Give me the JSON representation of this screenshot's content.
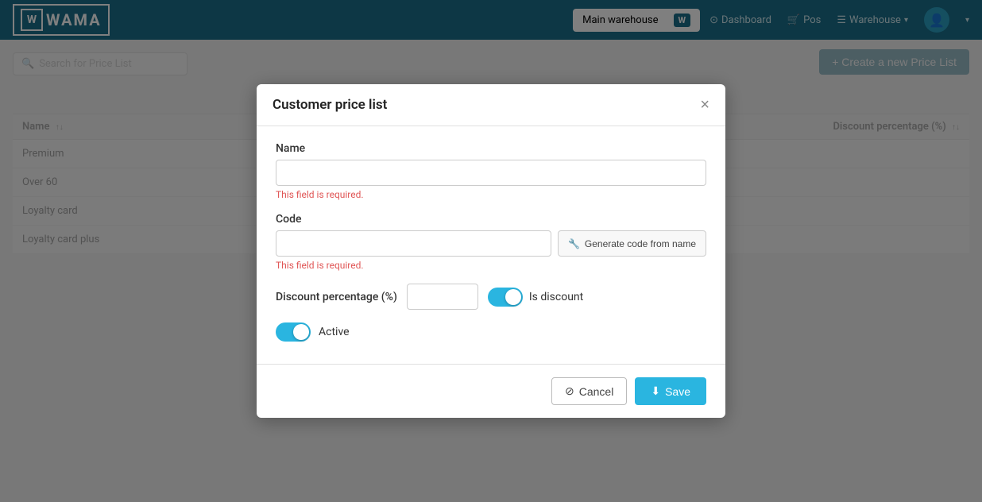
{
  "navbar": {
    "logo_text": "WAMA",
    "warehouse_name": "Main warehouse",
    "warehouse_badge": "W",
    "nav_dashboard": "Dashboard",
    "nav_pos": "Pos",
    "nav_warehouse": "Warehouse",
    "user_icon": "👤"
  },
  "page": {
    "search_placeholder": "Search for Price List",
    "create_btn_label": "+ Create a new Price List",
    "table": {
      "col_name": "Name",
      "col_discount": "Discount percentage (%)",
      "rows": [
        {
          "name": "Premium"
        },
        {
          "name": "Over 60"
        },
        {
          "name": "Loyalty card"
        },
        {
          "name": "Loyalty card plus"
        }
      ]
    }
  },
  "modal": {
    "title": "Customer price list",
    "close_label": "×",
    "name_label": "Name",
    "name_placeholder": "",
    "name_error": "This field is required.",
    "code_label": "Code",
    "code_placeholder": "",
    "code_error": "This field is required.",
    "gen_code_btn": "Generate code from name",
    "discount_label": "Discount percentage (%)",
    "discount_value": "",
    "is_discount_label": "Is discount",
    "active_label": "Active",
    "cancel_btn": "Cancel",
    "save_btn": "Save"
  }
}
